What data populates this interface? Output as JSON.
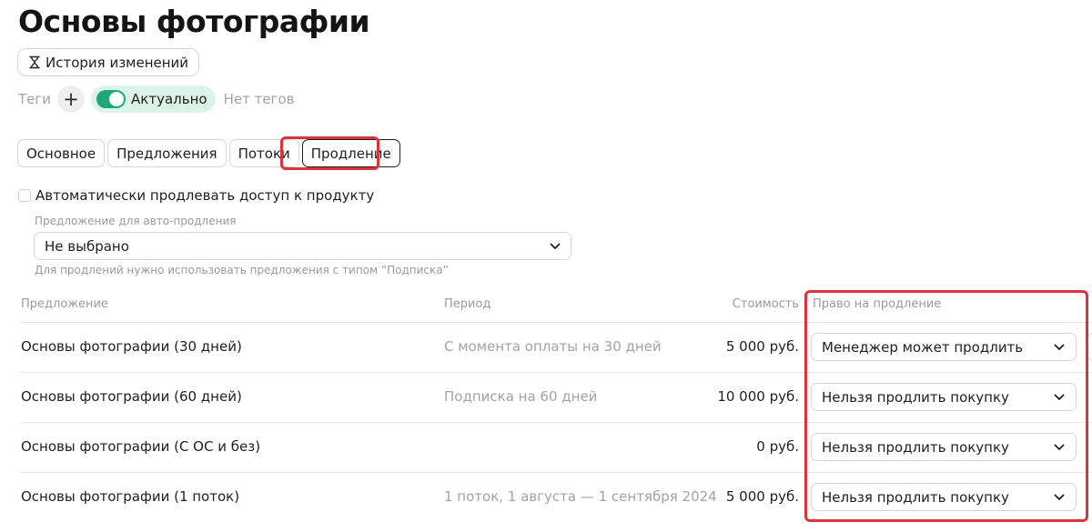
{
  "page": {
    "title": "Основы фотографии"
  },
  "history_button": {
    "label": "История изменений",
    "icon": "hourglass-icon"
  },
  "tags": {
    "label": "Теги",
    "add_icon": "+",
    "status": "Актуально",
    "empty": "Нет тегов"
  },
  "tabs": [
    {
      "label": "Основное",
      "active": false
    },
    {
      "label": "Предложения",
      "active": false
    },
    {
      "label": "Потоки",
      "active": false
    },
    {
      "label": "Продление",
      "active": true
    }
  ],
  "renewal": {
    "auto_renew_label": "Автоматически продлевать доступ к продукту",
    "auto_renew_checked": false,
    "offer_label": "Предложение для авто-продления",
    "offer_value": "Не выбрано",
    "offer_hint": "Для продлений нужно использовать предложения с типом “Подписка”"
  },
  "table": {
    "headers": {
      "offer": "Предложение",
      "period": "Период",
      "price": "Стоимость",
      "renewal_right": "Право на продление"
    },
    "rows": [
      {
        "name": "Основы фотографии (30 дней)",
        "period": "С момента оплаты на 30 дней",
        "price": "5 000 руб.",
        "renewal": "Менеджер может продлить"
      },
      {
        "name": "Основы фотографии (60 дней)",
        "period": "Подписка на 60 дней",
        "price": "10 000 руб.",
        "renewal": "Нельзя продлить покупку"
      },
      {
        "name": "Основы фотографии (С ОС и без)",
        "period": "",
        "price": "0 руб.",
        "renewal": "Нельзя продлить покупку"
      },
      {
        "name": "Основы фотографии (1 поток)",
        "period": "1 поток, 1 августа — 1 сентября 2024",
        "price": "5 000 руб.",
        "renewal": "Нельзя продлить покупку"
      }
    ]
  },
  "colors": {
    "accent_green": "#1fa67a",
    "status_bg": "#dcf3ea",
    "highlight_red": "#d9343a"
  }
}
